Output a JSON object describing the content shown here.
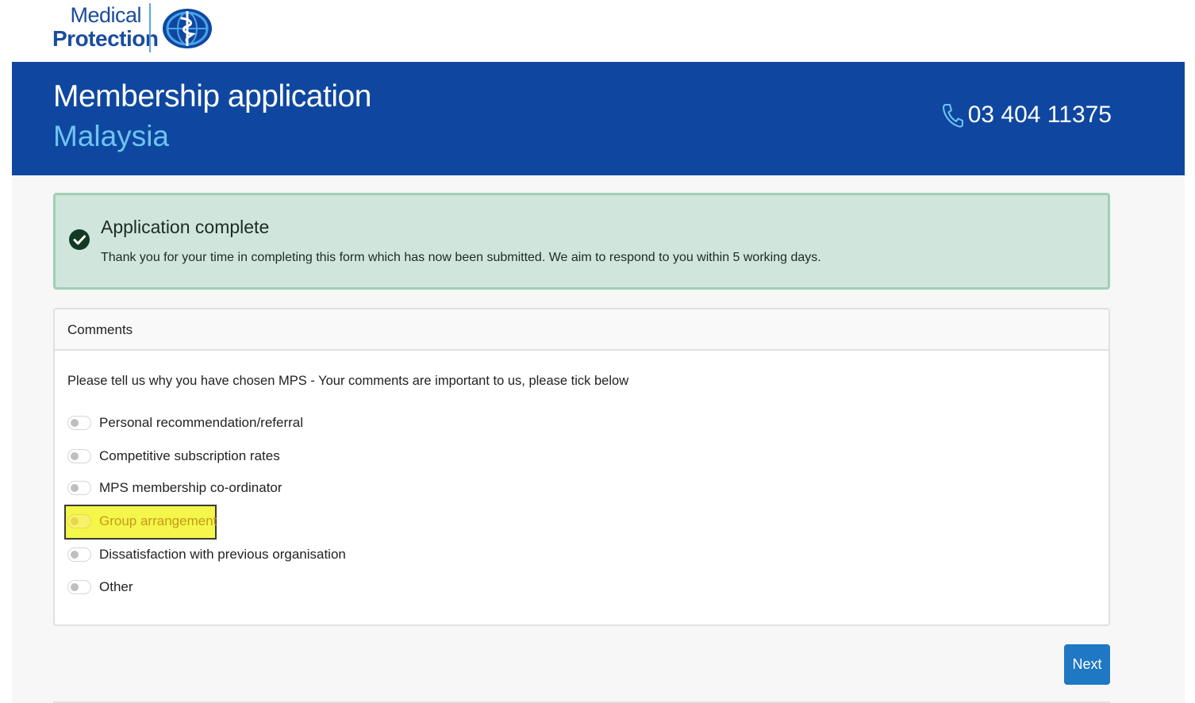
{
  "logo": {
    "line1": "Medical",
    "line2": "Protection",
    "emblem": "caduceus-globe-icon"
  },
  "header": {
    "title": "Membership application",
    "subtitle": "Malaysia",
    "phone": "03 404 11375",
    "phone_icon": "phone-icon"
  },
  "alert": {
    "icon": "check-circle-icon",
    "title": "Application complete",
    "text": "Thank you for your time in completing this form which has now been submitted. We aim to respond to you within 5 working days."
  },
  "comments": {
    "title": "Comments",
    "intro": "Please tell us why you have chosen MPS - Your comments are important to us, please tick below",
    "options": [
      {
        "label": "Personal recommendation/referral",
        "checked": false
      },
      {
        "label": "Competitive subscription rates",
        "checked": false
      },
      {
        "label": "MPS membership co-ordinator",
        "checked": false
      },
      {
        "label": "Group arrangement",
        "checked": false,
        "highlighted": true
      },
      {
        "label": "Dissatisfaction with previous organisation",
        "checked": false
      },
      {
        "label": "Other",
        "checked": false
      }
    ]
  },
  "actions": {
    "next_label": "Next"
  },
  "colors": {
    "header_bg": "#0f47a0",
    "subtitle": "#6ec4f2",
    "alert_bg": "#d0e6dc",
    "alert_border": "#9fd0b5",
    "button_bg": "#1f78c3",
    "highlight": "#f4f64a"
  }
}
